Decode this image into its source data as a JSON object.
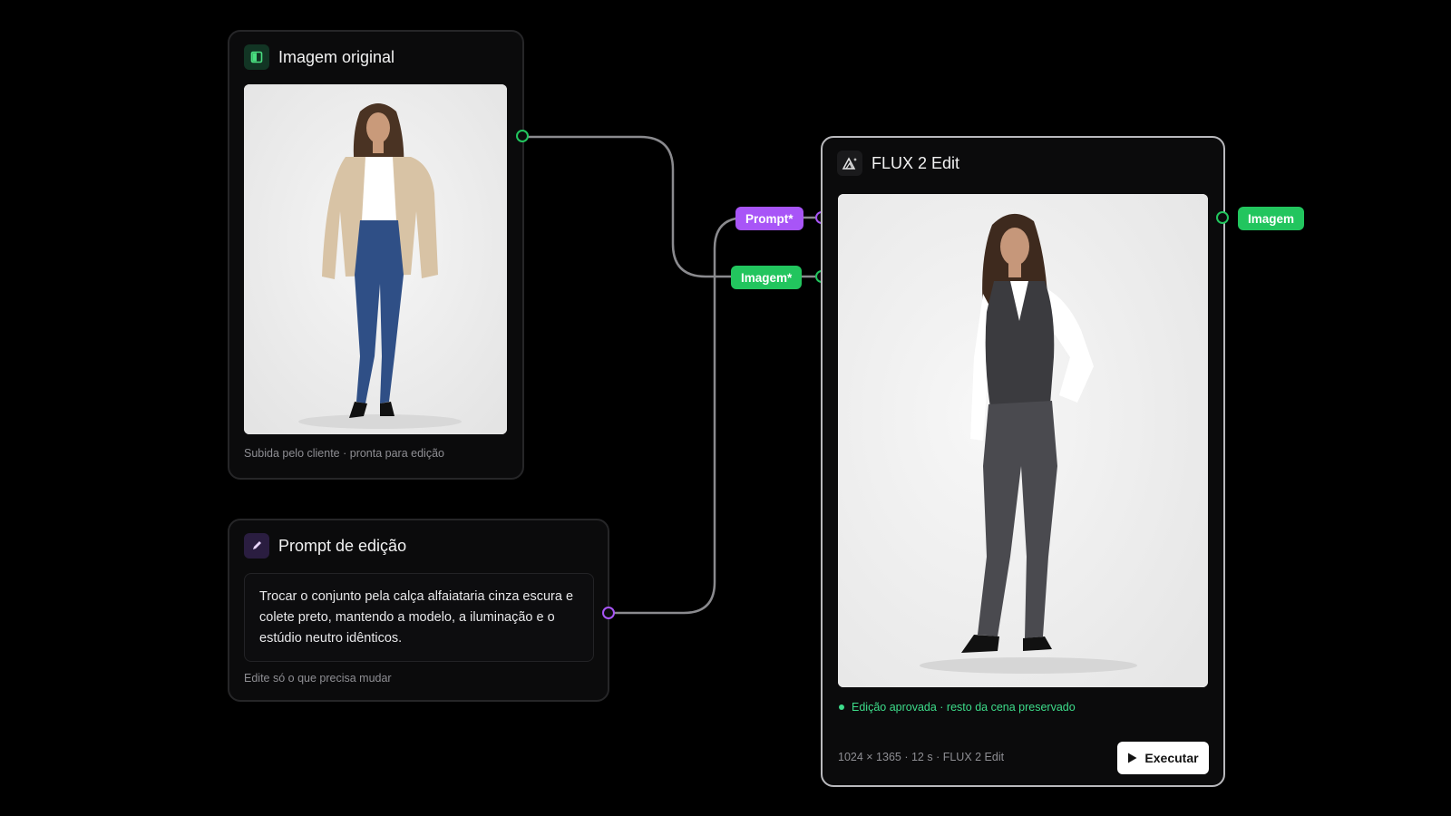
{
  "nodes": {
    "original": {
      "title": "Imagem original",
      "caption": "Subida pelo cliente · pronta para edição",
      "icon": "image-panel-icon"
    },
    "prompt": {
      "title": "Prompt de edição",
      "text": "Trocar o conjunto pela calça alfaiataria cinza escura e colete preto, mantendo a modelo, a iluminação e o estúdio neutro idênticos.",
      "caption": "Edite só o que precisa mudar",
      "icon": "pencil-icon"
    },
    "flux": {
      "title": "FLUX 2 Edit",
      "inputs": [
        "Prompt*",
        "Imagem*"
      ],
      "output": "Imagem",
      "status": "Edição aprovada · resto da cena preservado",
      "meta": "1024 × 1365 · 12 s · FLUX 2 Edit",
      "run_label": "Executar",
      "icon": "mountain-sparkle-icon"
    }
  },
  "colors": {
    "image_port": "#22c55e",
    "prompt_port": "#a855f7",
    "wire": "#8a8a8e",
    "status": "#3ddc8a"
  }
}
